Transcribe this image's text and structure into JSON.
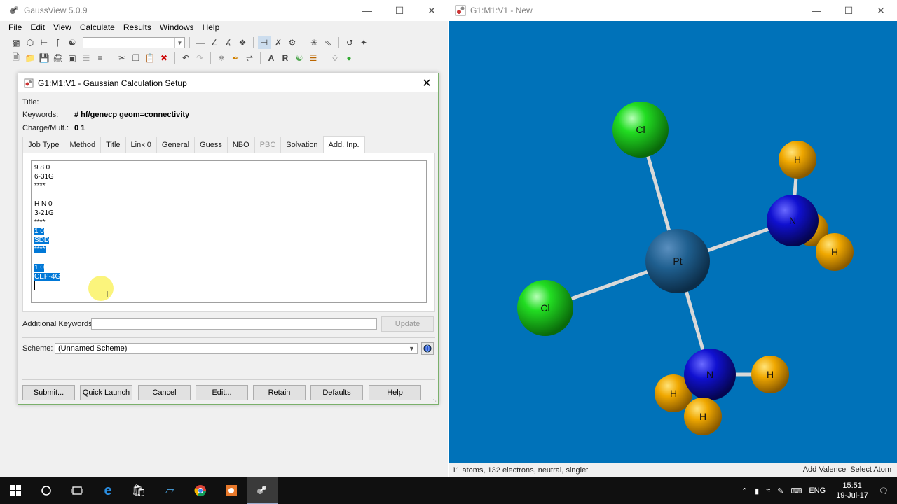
{
  "main_window": {
    "title": "GaussView 5.0.9",
    "menu": [
      "File",
      "Edit",
      "View",
      "Calculate",
      "Results",
      "Windows",
      "Help"
    ],
    "scheme_combo": "(Unnamed Scheme)"
  },
  "dialog": {
    "title": "G1:M1:V1 - Gaussian Calculation Setup",
    "title_label": "Title:",
    "keywords_label": "Keywords:",
    "keywords_value": "# hf/genecp geom=connectivity",
    "charge_label": "Charge/Mult.:",
    "charge_value": "0 1",
    "tabs": [
      "Job Type",
      "Method",
      "Title",
      "Link 0",
      "General",
      "Guess",
      "NBO",
      "PBC",
      "Solvation",
      "Add. Inp."
    ],
    "active_tab": "Add. Inp.",
    "disabled_tab": "PBC",
    "input_lines": [
      "9 8 0",
      "6-31G",
      "****",
      "",
      "H N 0",
      "3-21G",
      "****",
      "1 0",
      "SDD",
      "****",
      "",
      "1 0",
      "CEP-4G"
    ],
    "additional_keywords_label": "Additional Keywords:",
    "update_button": "Update",
    "scheme_label": "Scheme:",
    "scheme_value": "(Unnamed Scheme)",
    "buttons": [
      "Submit...",
      "Quick Launch",
      "Cancel",
      "Edit...",
      "Retain",
      "Defaults",
      "Help"
    ]
  },
  "molecule_window": {
    "title": "G1:M1:V1 - New",
    "status_left": "11 atoms, 132 electrons, neutral, singlet",
    "status_right_1": "Add Valence",
    "status_right_2": "Select Atom",
    "atoms": [
      "Cl",
      "Cl",
      "Pt",
      "N",
      "N",
      "H",
      "H",
      "H",
      "H",
      "H"
    ],
    "colors": {
      "background": "#0072b9",
      "pt": "#1f5f8f",
      "cl": "#22dd22",
      "n": "#1010d0",
      "h": "#f0a800"
    }
  },
  "taskbar": {
    "language": "ENG",
    "time": "15:51",
    "date": "19-Jul-17"
  }
}
